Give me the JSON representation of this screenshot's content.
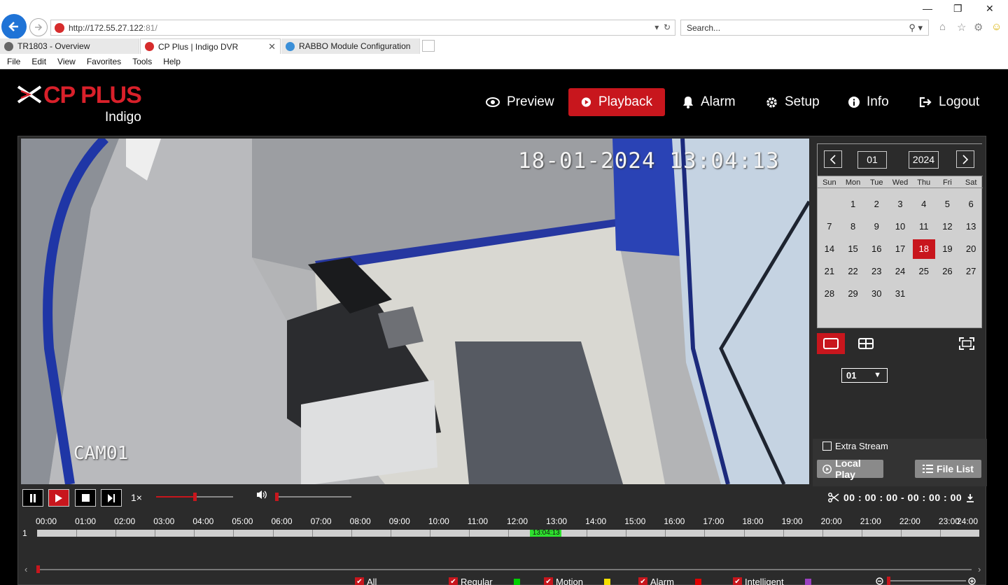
{
  "browser": {
    "url_main": "http://172.55.27.122",
    "url_port": ":81/",
    "search_placeholder": "Search...",
    "tabs": [
      {
        "label": "TR1803 - Overview"
      },
      {
        "label": "CP Plus | Indigo DVR"
      },
      {
        "label": "RABBO Module Configuration"
      }
    ],
    "menu": [
      "File",
      "Edit",
      "View",
      "Favorites",
      "Tools",
      "Help"
    ]
  },
  "app": {
    "brand": "CP PLUS",
    "brand_sub": "Indigo",
    "nav": [
      {
        "label": "Preview",
        "icon": "eye-icon"
      },
      {
        "label": "Playback",
        "icon": "play-circle-icon",
        "active": true
      },
      {
        "label": "Alarm",
        "icon": "bell-icon"
      },
      {
        "label": "Setup",
        "icon": "gear-icon"
      },
      {
        "label": "Info",
        "icon": "info-icon"
      },
      {
        "label": "Logout",
        "icon": "logout-icon"
      }
    ],
    "accent": "#c8161d"
  },
  "video": {
    "timestamp": "18-01-2024 13:04:13",
    "camera_label": "CAM01"
  },
  "calendar": {
    "month": "01",
    "year": "2024",
    "weekdays": [
      "Sun",
      "Mon",
      "Tue",
      "Wed",
      "Thu",
      "Fri",
      "Sat"
    ],
    "days": [
      "",
      "1",
      "2",
      "3",
      "4",
      "5",
      "6",
      "7",
      "8",
      "9",
      "10",
      "11",
      "12",
      "13",
      "14",
      "15",
      "16",
      "17",
      "18",
      "19",
      "20",
      "21",
      "22",
      "23",
      "24",
      "25",
      "26",
      "27",
      "28",
      "29",
      "30",
      "31"
    ],
    "selected_day": "18"
  },
  "channel": {
    "selected": "01",
    "extra_stream_label": "Extra Stream",
    "local_play_label": "Local Play",
    "file_list_label": "File List"
  },
  "playback": {
    "speed": "1×",
    "progress_fraction": 0.5,
    "volume_fraction": 0.0,
    "clip_time": "00 : 00 : 00 - 00 : 00 : 00"
  },
  "timeline": {
    "hours": [
      "00:00",
      "01:00",
      "02:00",
      "03:00",
      "04:00",
      "05:00",
      "06:00",
      "07:00",
      "08:00",
      "09:00",
      "10:00",
      "11:00",
      "12:00",
      "13:00",
      "14:00",
      "15:00",
      "16:00",
      "17:00",
      "18:00",
      "19:00",
      "20:00",
      "21:00",
      "22:00",
      "23:00",
      "24:00"
    ],
    "row_label": "1",
    "cursor_label": "13:04:13",
    "recording_start_hour": 12.55,
    "recording_end_hour": 13.35
  },
  "legend": [
    {
      "label": "All",
      "color": ""
    },
    {
      "label": "Regular",
      "color": "#00d000"
    },
    {
      "label": "Motion",
      "color": "#f5e000"
    },
    {
      "label": "Alarm",
      "color": "#e00000"
    },
    {
      "label": "Intelligent",
      "color": "#9b40c0"
    }
  ]
}
